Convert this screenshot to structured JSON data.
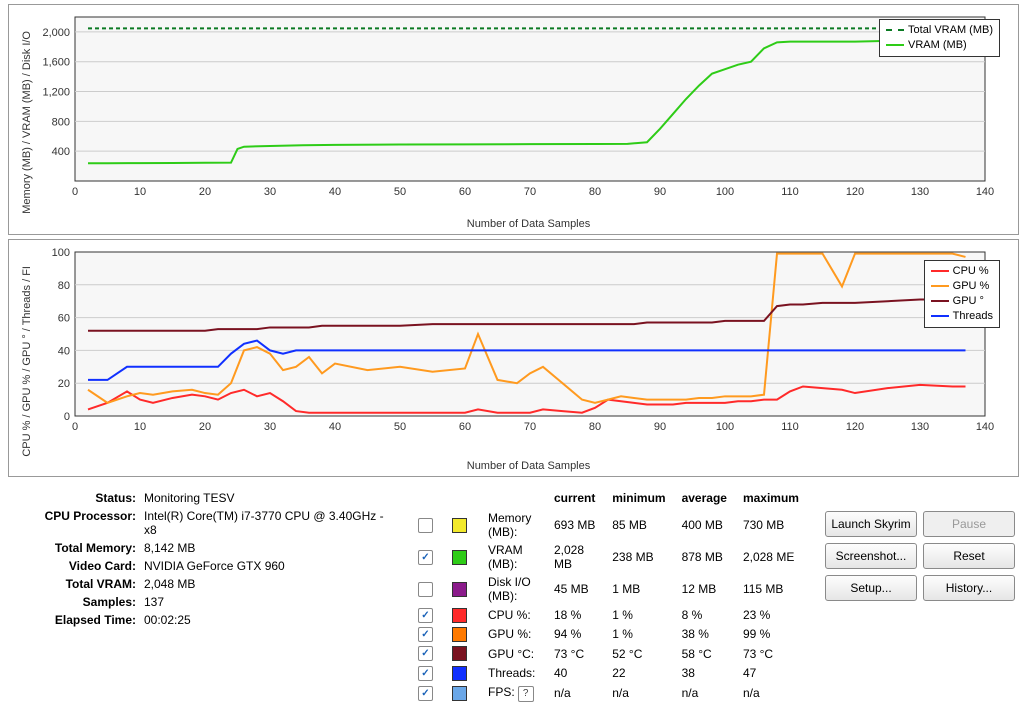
{
  "chart_data": [
    {
      "type": "line",
      "title": "",
      "xlabel": "Number of Data Samples",
      "ylabel": "Memory (MB) / VRAM (MB) / Disk I/O",
      "xlim": [
        0,
        140
      ],
      "ylim": [
        0,
        2200
      ],
      "x": [
        2,
        5,
        10,
        15,
        20,
        24,
        25,
        26,
        30,
        35,
        40,
        50,
        60,
        70,
        80,
        85,
        88,
        90,
        92,
        94,
        96,
        98,
        100,
        102,
        104,
        106,
        108,
        110,
        115,
        120,
        125,
        130,
        135,
        137
      ],
      "series": [
        {
          "name": "Total VRAM (MB)",
          "color": "#0b7a23",
          "dash": true,
          "values": [
            2048,
            2048,
            2048,
            2048,
            2048,
            2048,
            2048,
            2048,
            2048,
            2048,
            2048,
            2048,
            2048,
            2048,
            2048,
            2048,
            2048,
            2048,
            2048,
            2048,
            2048,
            2048,
            2048,
            2048,
            2048,
            2048,
            2048,
            2048,
            2048,
            2048,
            2048,
            2048,
            2048,
            2048
          ]
        },
        {
          "name": "VRAM (MB)",
          "color": "#2ecc17",
          "values": [
            238,
            238,
            240,
            242,
            244,
            246,
            430,
            460,
            470,
            480,
            484,
            490,
            492,
            494,
            496,
            498,
            520,
            700,
            900,
            1100,
            1280,
            1440,
            1500,
            1560,
            1600,
            1780,
            1860,
            1870,
            1870,
            1870,
            1880,
            1880,
            1885,
            1890
          ]
        }
      ],
      "yticks": [
        400,
        800,
        1200,
        1600,
        2000
      ],
      "xticks": [
        0,
        10,
        20,
        30,
        40,
        50,
        60,
        70,
        80,
        90,
        100,
        110,
        120,
        130,
        140
      ]
    },
    {
      "type": "line",
      "title": "",
      "xlabel": "Number of Data Samples",
      "ylabel": "CPU % / GPU % / GPU ° / Threads / FI",
      "xlim": [
        0,
        140
      ],
      "ylim": [
        0,
        100
      ],
      "x": [
        2,
        5,
        8,
        10,
        12,
        15,
        18,
        20,
        22,
        24,
        26,
        28,
        30,
        32,
        34,
        36,
        38,
        40,
        45,
        50,
        55,
        60,
        62,
        65,
        68,
        70,
        72,
        75,
        78,
        80,
        82,
        84,
        86,
        88,
        90,
        92,
        94,
        96,
        98,
        100,
        102,
        104,
        106,
        108,
        110,
        112,
        115,
        118,
        120,
        125,
        130,
        135,
        137
      ],
      "series": [
        {
          "name": "CPU %",
          "color": "#ff2a2a",
          "values": [
            4,
            8,
            15,
            10,
            8,
            11,
            13,
            12,
            10,
            14,
            16,
            12,
            14,
            9,
            3,
            2,
            2,
            2,
            2,
            2,
            2,
            2,
            4,
            2,
            2,
            2,
            4,
            3,
            2,
            5,
            10,
            9,
            8,
            7,
            7,
            7,
            8,
            8,
            8,
            8,
            9,
            9,
            10,
            10,
            15,
            18,
            17,
            16,
            14,
            17,
            19,
            18,
            18
          ]
        },
        {
          "name": "GPU %",
          "color": "#ff9a1f",
          "values": [
            16,
            8,
            12,
            14,
            13,
            15,
            16,
            14,
            13,
            20,
            40,
            42,
            38,
            28,
            30,
            36,
            26,
            32,
            28,
            30,
            27,
            29,
            50,
            22,
            20,
            26,
            30,
            20,
            10,
            8,
            10,
            12,
            11,
            10,
            10,
            10,
            10,
            11,
            11,
            12,
            12,
            12,
            13,
            99,
            99,
            99,
            99,
            79,
            99,
            99,
            99,
            99,
            97
          ]
        },
        {
          "name": "GPU °",
          "color": "#7a1220",
          "values": [
            52,
            52,
            52,
            52,
            52,
            52,
            52,
            52,
            53,
            53,
            53,
            53,
            54,
            54,
            54,
            54,
            55,
            55,
            55,
            55,
            56,
            56,
            56,
            56,
            56,
            56,
            56,
            56,
            56,
            56,
            56,
            56,
            56,
            57,
            57,
            57,
            57,
            57,
            57,
            58,
            58,
            58,
            58,
            67,
            68,
            68,
            69,
            69,
            69,
            70,
            71,
            71,
            71
          ]
        },
        {
          "name": "Threads",
          "color": "#1030ff",
          "values": [
            22,
            22,
            30,
            30,
            30,
            30,
            30,
            30,
            30,
            38,
            44,
            46,
            40,
            38,
            40,
            40,
            40,
            40,
            40,
            40,
            40,
            40,
            40,
            40,
            40,
            40,
            40,
            40,
            40,
            40,
            40,
            40,
            40,
            40,
            40,
            40,
            40,
            40,
            40,
            40,
            40,
            40,
            40,
            40,
            40,
            40,
            40,
            40,
            40,
            40,
            40,
            40,
            40
          ]
        }
      ],
      "yticks": [
        0,
        20,
        40,
        60,
        80,
        100
      ],
      "xticks": [
        0,
        10,
        20,
        30,
        40,
        50,
        60,
        70,
        80,
        90,
        100,
        110,
        120,
        130,
        140
      ]
    }
  ],
  "chart1": {
    "xlabel": "Number of Data Samples",
    "ylabel": "Memory (MB) / VRAM (MB) / Disk I/O",
    "legend": {
      "a": "Total VRAM (MB)",
      "b": "VRAM (MB)"
    }
  },
  "chart2": {
    "xlabel": "Number of Data Samples",
    "ylabel": "CPU % / GPU % / GPU ° / Threads / FI",
    "legend": {
      "a": "CPU %",
      "b": "GPU %",
      "c": "GPU °",
      "d": "Threads"
    }
  },
  "info": {
    "status": {
      "l": "Status:",
      "v": "Monitoring TESV"
    },
    "cpu": {
      "l": "CPU Processor:",
      "v": "Intel(R) Core(TM) i7-3770 CPU @ 3.40GHz - x8"
    },
    "mem": {
      "l": "Total Memory:",
      "v": "8,142 MB"
    },
    "gpu": {
      "l": "Video Card:",
      "v": "NVIDIA GeForce GTX 960"
    },
    "vram": {
      "l": "Total VRAM:",
      "v": "2,048 MB"
    },
    "samples": {
      "l": "Samples:",
      "v": "137"
    },
    "elapsed": {
      "l": "Elapsed Time:",
      "v": "00:02:25"
    }
  },
  "cols": {
    "cur": "current",
    "min": "minimum",
    "avg": "average",
    "max": "maximum"
  },
  "metrics": [
    {
      "on": false,
      "color": "#f2e92b",
      "name": "Memory (MB):",
      "cur": "693 MB",
      "min": "85 MB",
      "avg": "400 MB",
      "max": "730 MB"
    },
    {
      "on": true,
      "color": "#2ecc17",
      "name": "VRAM (MB):",
      "cur": "2,028 MB",
      "min": "238 MB",
      "avg": "878 MB",
      "max": "2,028 ME"
    },
    {
      "on": false,
      "color": "#8b1b8b",
      "name": "Disk I/O (MB):",
      "cur": "45 MB",
      "min": "1 MB",
      "avg": "12 MB",
      "max": "115 MB"
    },
    {
      "on": true,
      "color": "#ff2a2a",
      "name": "CPU %:",
      "cur": "18 %",
      "min": "1 %",
      "avg": "8 %",
      "max": "23 %"
    },
    {
      "on": true,
      "color": "#ff7a00",
      "name": "GPU %:",
      "cur": "94 %",
      "min": "1 %",
      "avg": "38 %",
      "max": "99 %"
    },
    {
      "on": true,
      "color": "#7a1220",
      "name": "GPU °C:",
      "cur": "73 °C",
      "min": "52 °C",
      "avg": "58 °C",
      "max": "73 °C"
    },
    {
      "on": true,
      "color": "#1030ff",
      "name": "Threads:",
      "cur": "40",
      "min": "22",
      "avg": "38",
      "max": "47"
    },
    {
      "on": true,
      "color": "#6aa7e8",
      "name": "FPS:",
      "help": true,
      "cur": "n/a",
      "min": "n/a",
      "avg": "n/a",
      "max": "n/a"
    }
  ],
  "buttons": {
    "launch": "Launch Skyrim",
    "pause": "Pause",
    "shot": "Screenshot...",
    "reset": "Reset",
    "setup": "Setup...",
    "hist": "History..."
  }
}
